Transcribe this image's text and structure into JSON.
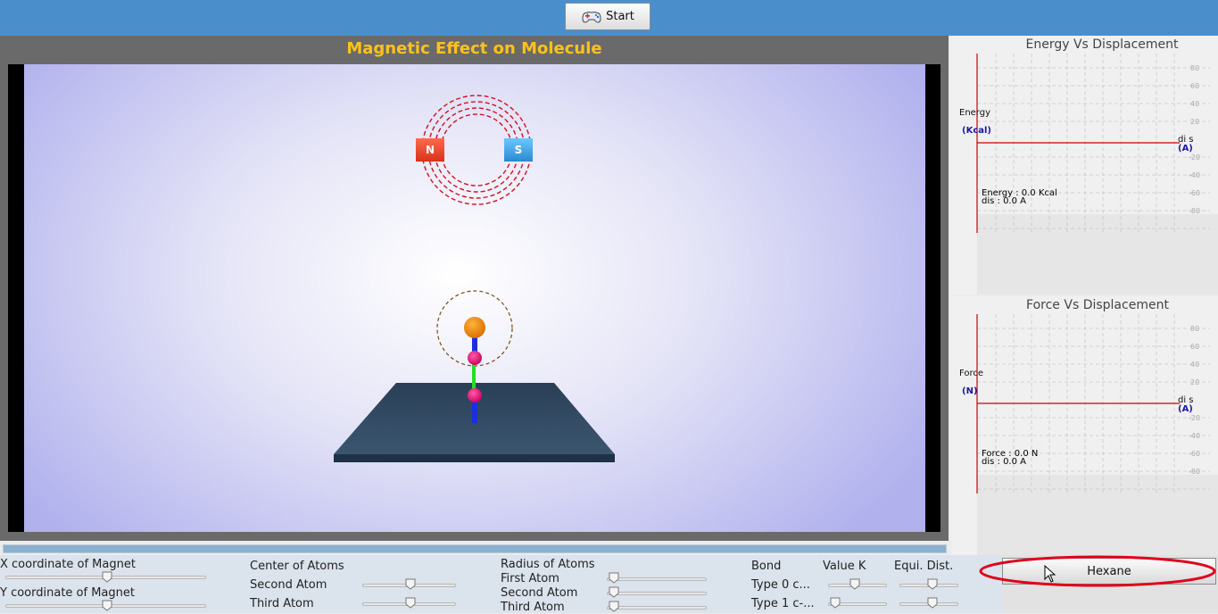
{
  "toolbar": {
    "start_label": "Start"
  },
  "simulation": {
    "title": "Magnetic Effect on Molecule",
    "north_label": "N",
    "south_label": "S",
    "progress": 1.0
  },
  "energy_graph": {
    "title": "Energy Vs Displacement",
    "y_label": "Energy",
    "y_unit": "(Kcal)",
    "x_label": "di s",
    "x_unit": "(A)",
    "readout_line1": "Energy : 0.0 Kcal",
    "readout_line2": "dis : 0.0 A",
    "ticks": [
      "80",
      "60",
      "40",
      "20",
      "0",
      "-20",
      "-40",
      "-60",
      "-80"
    ]
  },
  "force_graph": {
    "title": "Force Vs Displacement",
    "y_label": "Force",
    "y_unit": "(N)",
    "x_label": "di s",
    "x_unit": "(A)",
    "readout_line1": "Force : 0.0 N",
    "readout_line2": "dis : 0.0 A",
    "ticks": [
      "80",
      "60",
      "40",
      "20",
      "0",
      "-20",
      "-40",
      "-60",
      "-80"
    ]
  },
  "controls": {
    "x_magnet": "X coordinate of Magnet",
    "y_magnet": "Y coordinate of Magnet",
    "center_atoms": "Center of Atoms",
    "second_atom": "Second Atom",
    "third_atom": "Third Atom",
    "radius_atoms": "Radius of Atoms",
    "radius_first": "First Atom",
    "radius_second": "Second Atom",
    "radius_third": "Third Atom",
    "bond": "Bond",
    "value_k": "Value K",
    "equi_dist": "Equi. Dist.",
    "bond_type0": "Type 0  c...",
    "bond_type1": "Type 1 c-..."
  },
  "hexane_button": {
    "label": "Hexane"
  },
  "colors": {
    "topbar": "#4a8fcc",
    "title": "#ffc21a",
    "graph_axis": "#cc0000",
    "annotation": "#e0001a"
  }
}
